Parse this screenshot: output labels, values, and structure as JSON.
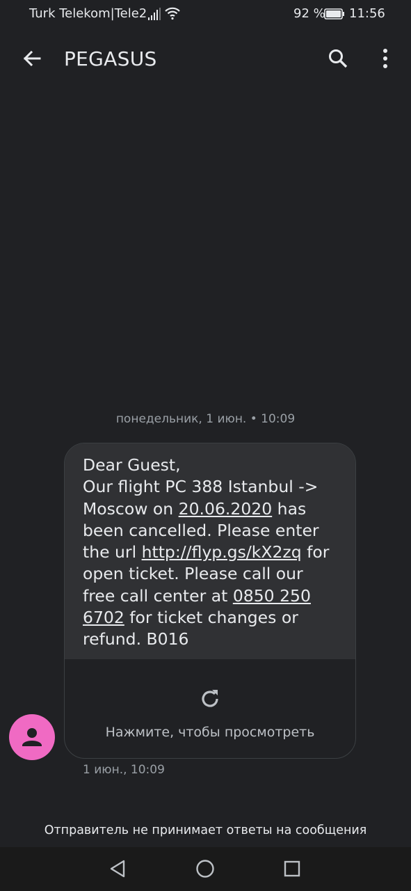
{
  "status_bar": {
    "carrier": "Turk Telekom|Tele2",
    "battery_percent": "92 %",
    "time": "11:56",
    "icons": [
      "signal-icon",
      "wifi-icon",
      "battery-icon"
    ]
  },
  "app_bar": {
    "title": "PEGASUS",
    "icons": [
      "back-arrow-icon",
      "search-icon",
      "more-vert-icon"
    ]
  },
  "conversation": {
    "date_divider": "понедельник, 1 июн. • 10:09",
    "message": {
      "line1": "Dear Guest,",
      "text_before_date": "Our flight PC 388 Istanbul -> Moscow on ",
      "date_link": "20.06.2020",
      "text_before_url": " has been cancelled. Please enter the url ",
      "url_link": "http://flyp.gs/kX2zq",
      "text_before_phone": " for open ticket. Please call our free call center at ",
      "phone_link": "0850 250 6702",
      "text_after_phone": " for ticket changes or refund. B016"
    },
    "preview_label": "Нажмите, чтобы просмотреть",
    "timestamp": "1 июн., 10:09",
    "avatar_icon": "person-icon",
    "avatar_color": "#f06ac3"
  },
  "footer_notice": "Отправитель не принимает ответы на сообщения",
  "nav_bar": {
    "icons": [
      "nav-back-icon",
      "nav-home-icon",
      "nav-recents-icon"
    ]
  }
}
